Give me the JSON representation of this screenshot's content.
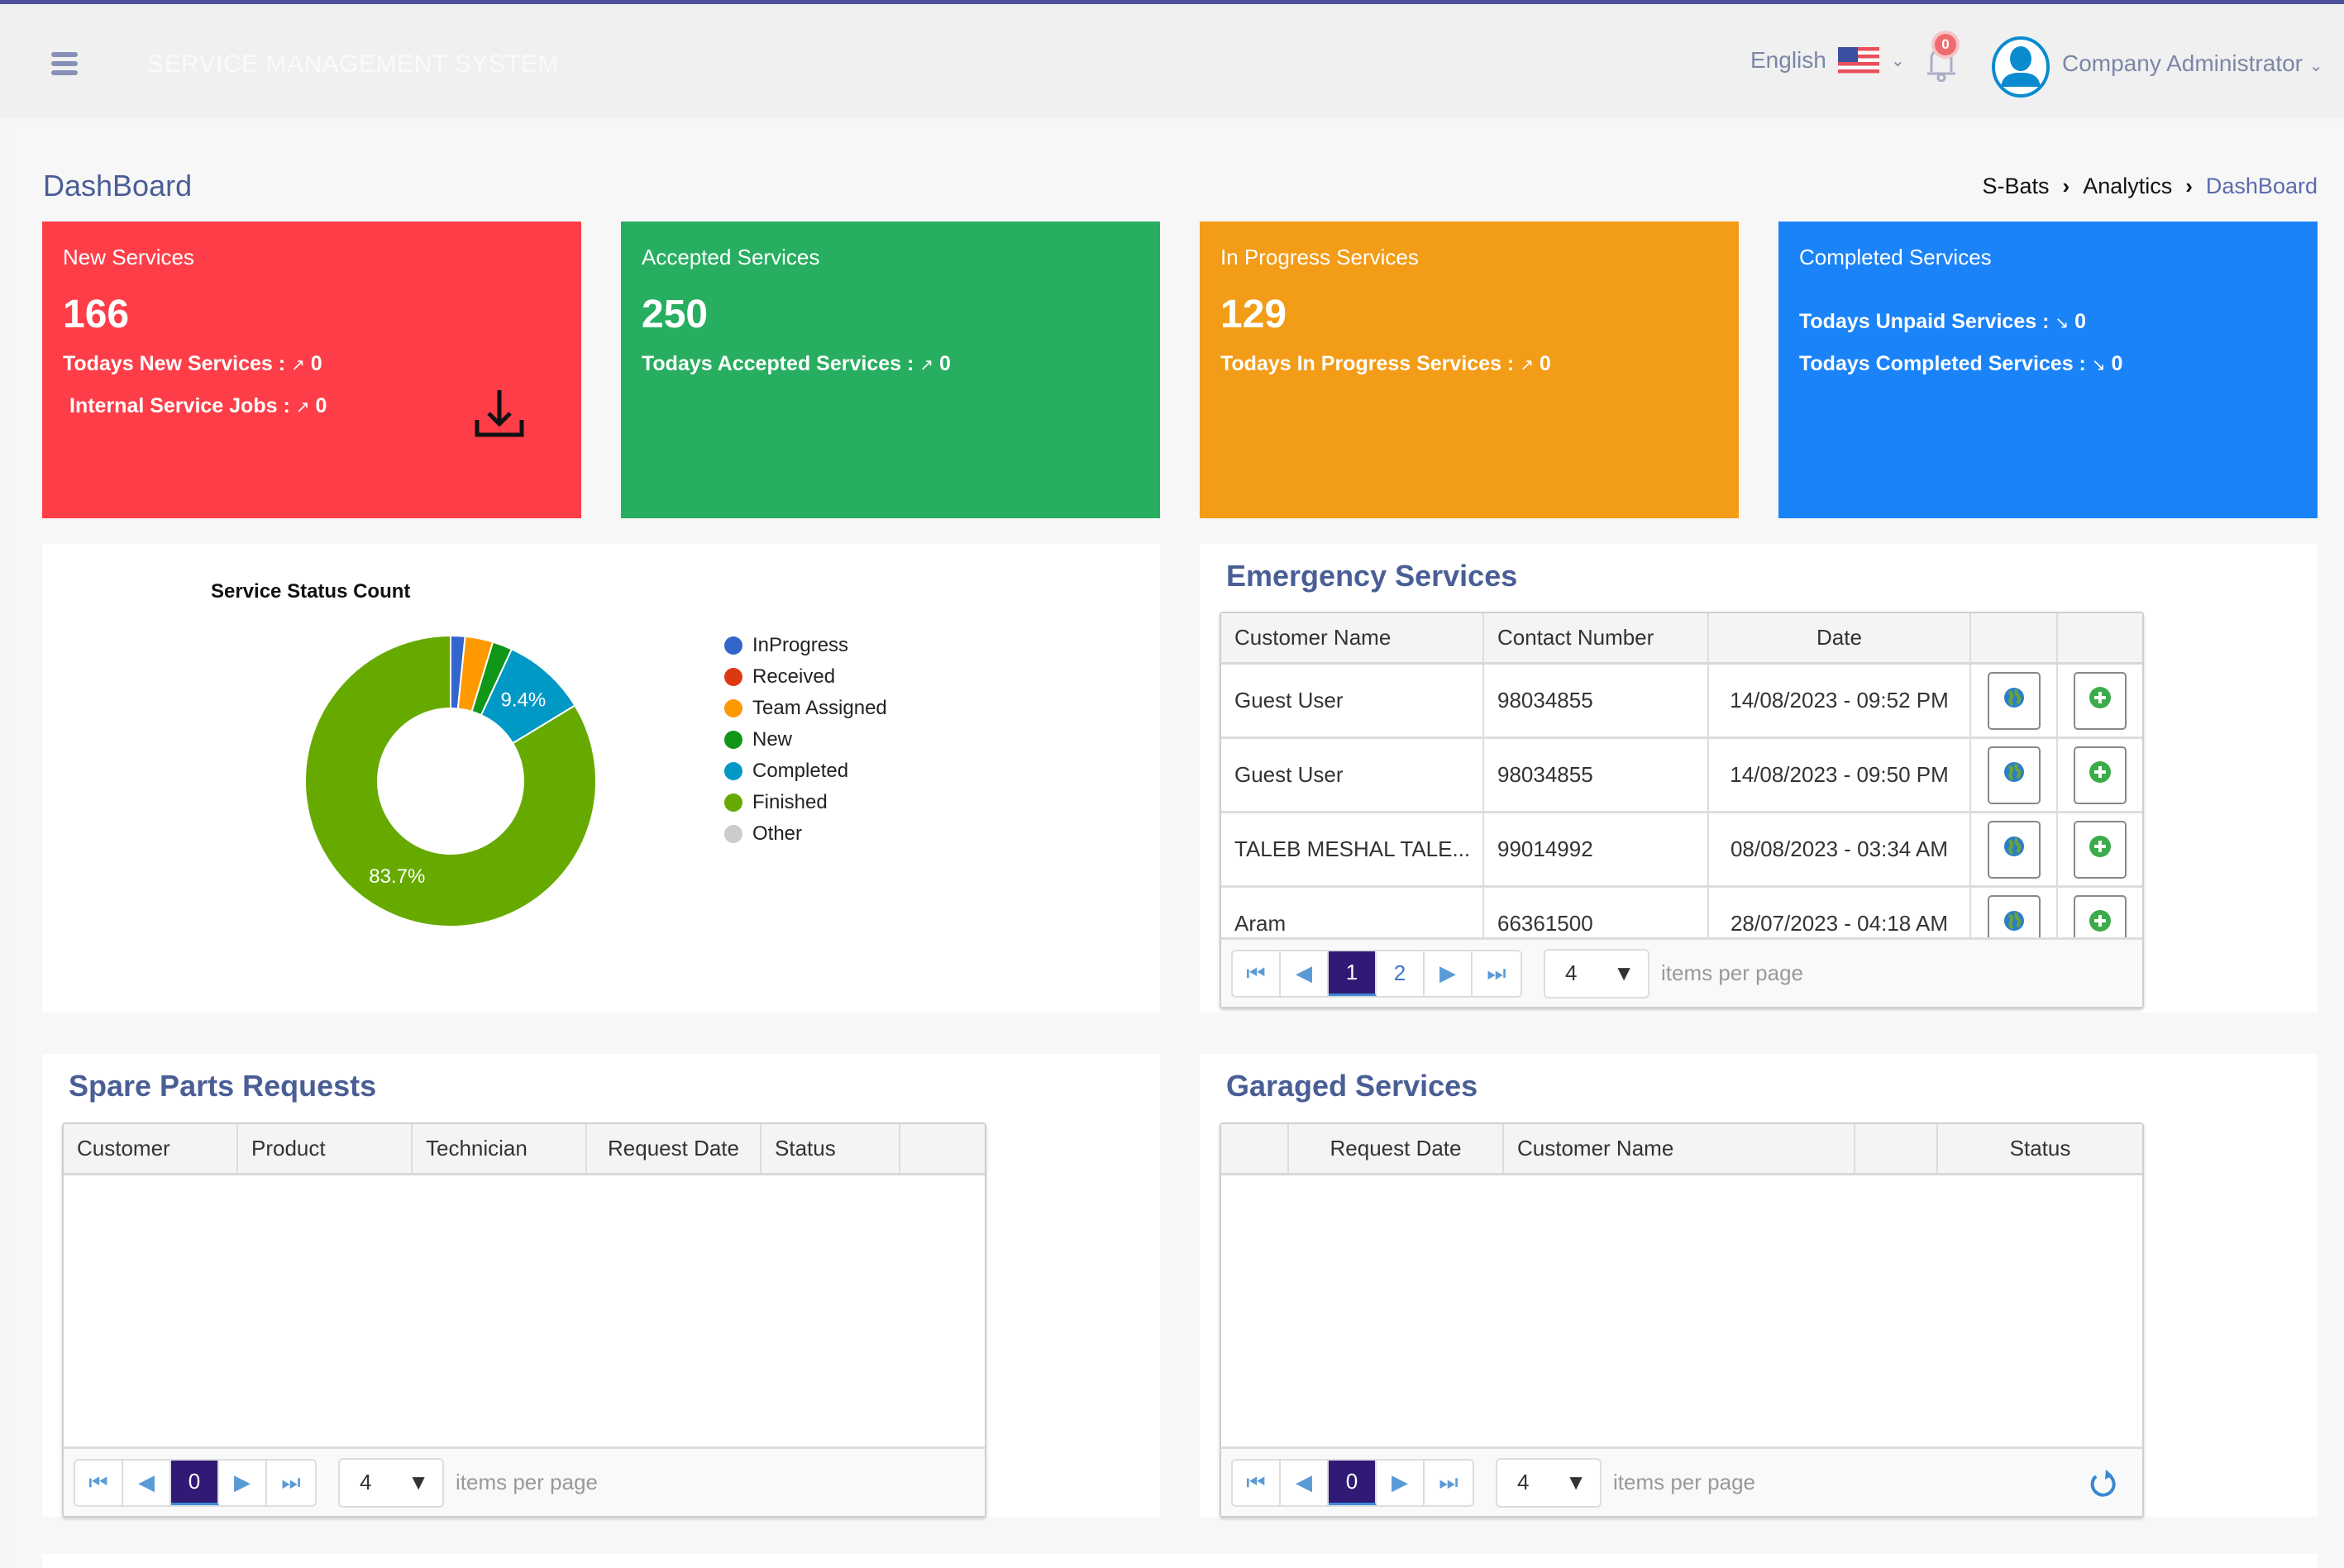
{
  "header": {
    "app_title": "SERVICE MANAGEMENT SYSTEM",
    "language": "English",
    "notification_count": "0",
    "user_name": "Company Administrator",
    "icons": {
      "menu": "hamburger-icon",
      "flag": "us-flag-icon",
      "bell": "bell-icon",
      "avatar": "user-avatar-icon"
    }
  },
  "page": {
    "title": "DashBoard",
    "breadcrumb": [
      "S-Bats",
      "Analytics",
      "DashBoard"
    ]
  },
  "cards": [
    {
      "title": "New Services",
      "value": "166",
      "color": "#fd3e48",
      "lines": [
        {
          "label": "Todays New Services :",
          "value": "0",
          "trend": "up"
        },
        {
          "label": "Internal Service Jobs :",
          "value": "0",
          "trend": "up"
        }
      ],
      "has_download": true
    },
    {
      "title": "Accepted Services",
      "value": "250",
      "color": "#27ae60",
      "lines": [
        {
          "label": "Todays Accepted Services :",
          "value": "0",
          "trend": "up"
        }
      ]
    },
    {
      "title": "In Progress Services",
      "value": "129",
      "color": "#f39c17",
      "lines": [
        {
          "label": "Todays In Progress Services :",
          "value": "0",
          "trend": "up"
        }
      ]
    },
    {
      "title": "Completed Services",
      "value": "",
      "color": "#1a83f8",
      "lines": [
        {
          "label": "Todays Unpaid Services :",
          "value": "0",
          "trend": "down"
        },
        {
          "label": "Todays Completed Services :",
          "value": "0",
          "trend": "down"
        }
      ]
    }
  ],
  "chart_data": {
    "type": "pie",
    "donut": true,
    "title": "Service Status Count",
    "legend_position": "right",
    "categories": [
      "InProgress",
      "Received",
      "Team Assigned",
      "New",
      "Completed",
      "Finished",
      "Other"
    ],
    "values": [
      1.6,
      0,
      3.1,
      2.2,
      9.4,
      83.7,
      0
    ],
    "colors": [
      "#3366cc",
      "#dc3912",
      "#ff9900",
      "#109618",
      "#0099c6",
      "#66aa00",
      "#cccccc"
    ],
    "data_labels": {
      "Completed": "9.4%",
      "Finished": "83.7%"
    }
  },
  "emergency": {
    "title": "Emergency Services",
    "columns": [
      "Customer Name",
      "Contact Number",
      "Date",
      "",
      ""
    ],
    "rows": [
      {
        "name": "Guest User",
        "contact": "98034855",
        "date": "14/08/2023 - 09:52 PM"
      },
      {
        "name": "Guest User",
        "contact": "98034855",
        "date": "14/08/2023 - 09:50 PM"
      },
      {
        "name": "TALEB MESHAL TALE...",
        "contact": "99014992",
        "date": "08/08/2023 - 03:34 AM"
      },
      {
        "name": "Aram",
        "contact": "66361500",
        "date": "28/07/2023 - 04:18 AM"
      }
    ],
    "pages": [
      "1",
      "2"
    ],
    "current_page": "1",
    "page_size": "4",
    "items_per_page_label": "items per page"
  },
  "spare_parts": {
    "title": "Spare Parts Requests",
    "columns": [
      "Customer",
      "Product",
      "Technician",
      "Request Date",
      "Status",
      ""
    ],
    "rows": [],
    "current_page": "0",
    "page_size": "4",
    "items_per_page_label": "items per page"
  },
  "garaged": {
    "title": "Garaged Services",
    "columns": [
      "",
      "Request Date",
      "Customer Name",
      "",
      "Status"
    ],
    "rows": [],
    "current_page": "0",
    "page_size": "4",
    "items_per_page_label": "items per page"
  }
}
